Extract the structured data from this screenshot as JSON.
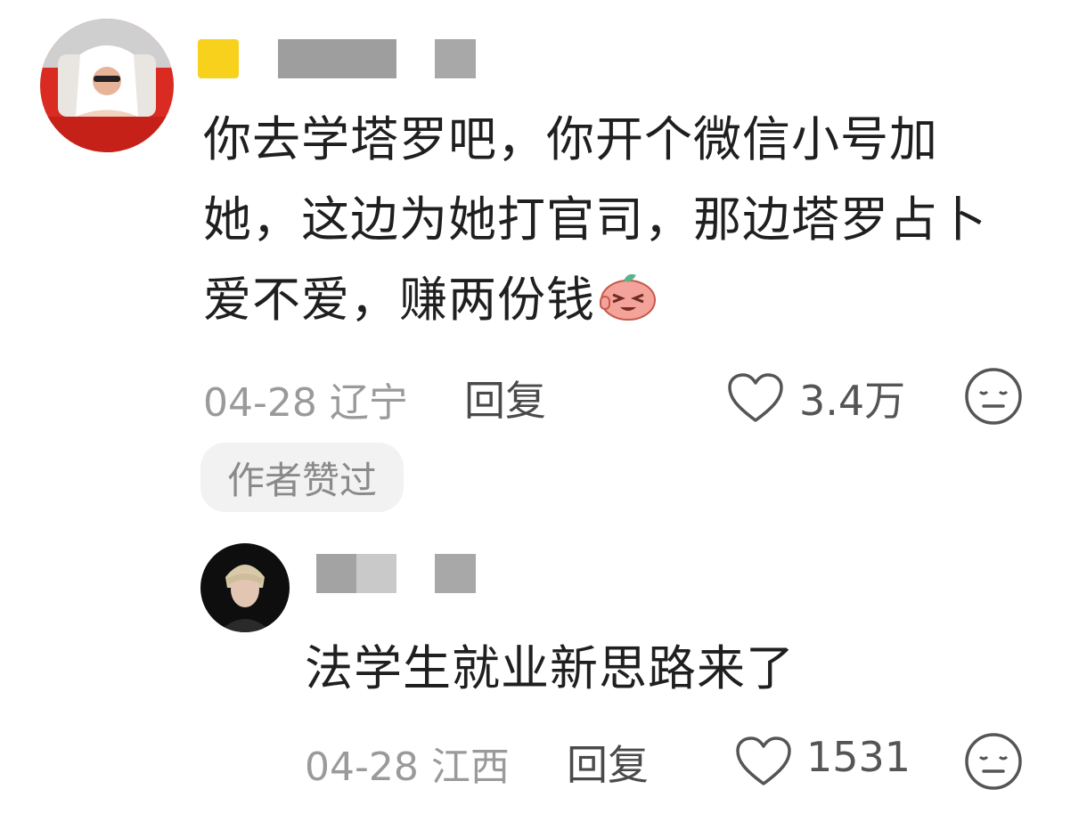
{
  "comments": [
    {
      "text": "你去学塔罗吧，你开个微信小号加她，这边为她打官司，那边塔罗占卜爱不爱，赚两份钱",
      "date_location": "04-28 辽宁",
      "reply_label": "回复",
      "like_count": "3.4万",
      "badge": "作者赞过"
    },
    {
      "text": "法学生就业新思路来了",
      "date_location": "04-28 江西",
      "reply_label": "回复",
      "like_count": "1531"
    }
  ],
  "icons": {
    "like": "heart-outline-icon",
    "dislike": "meh-face-icon",
    "emoji": "laughing-peach-emoji"
  },
  "colors": {
    "name_badge_yellow": "#f7d11b",
    "redacted_gray": "#9e9e9e",
    "badge_bg": "#f2f2f2"
  }
}
